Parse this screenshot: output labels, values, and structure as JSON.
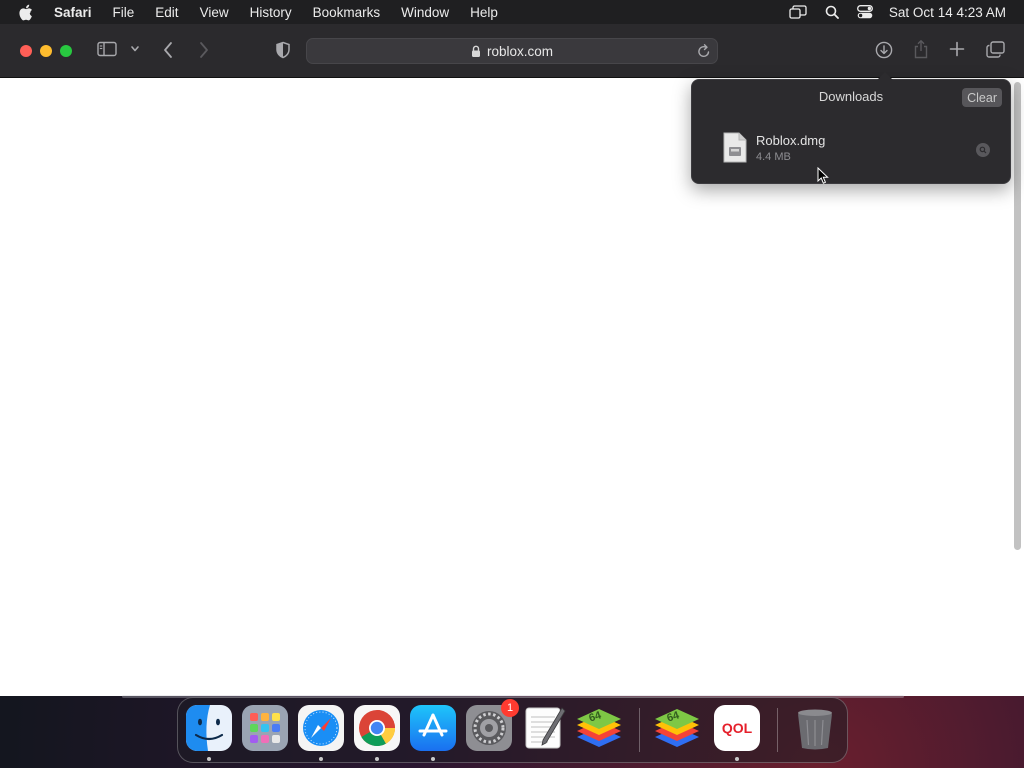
{
  "menubar": {
    "app_name": "Safari",
    "items": [
      "File",
      "Edit",
      "View",
      "History",
      "Bookmarks",
      "Window",
      "Help"
    ],
    "clock": "Sat Oct 14  4:23 AM"
  },
  "toolbar": {
    "address": "roblox.com"
  },
  "downloads": {
    "title": "Downloads",
    "clear_label": "Clear",
    "items": [
      {
        "name": "Roblox.dmg",
        "size": "4.4 MB"
      }
    ]
  },
  "dock": {
    "apps": [
      "Finder",
      "Launchpad",
      "Safari",
      "Google Chrome",
      "App Store",
      "System Settings",
      "TextEdit",
      "BlueStacks",
      "BlueStacks",
      "QOL"
    ],
    "badge_count": "1",
    "qol_label": "QOL",
    "bluestacks_label": "64"
  },
  "colors": {
    "toolbar_bg": "#2b2a2d",
    "menubar_bg": "#1f1f21",
    "popover_bg": "#2c2b2e",
    "badge": "#ff3b30"
  }
}
